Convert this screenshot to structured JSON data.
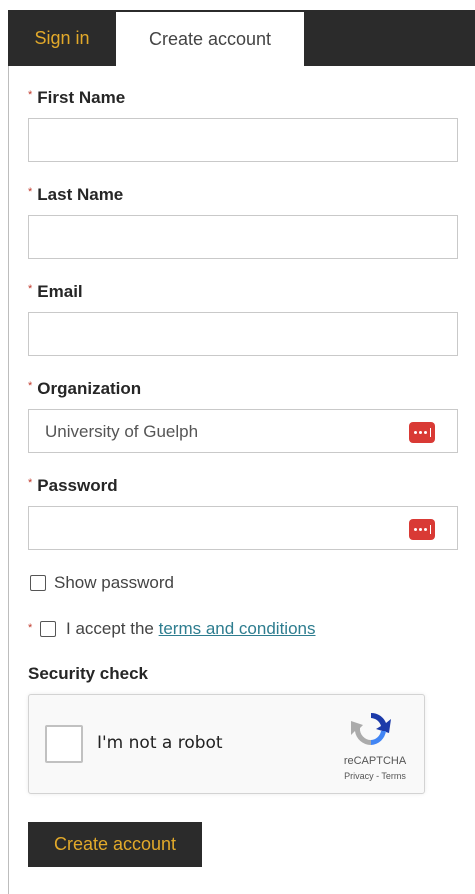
{
  "tabs": {
    "signin": "Sign in",
    "create": "Create account"
  },
  "form": {
    "first_name_label": "First Name",
    "last_name_label": "Last Name",
    "email_label": "Email",
    "organization_label": "Organization",
    "organization_value": "University of Guelph",
    "password_label": "Password",
    "required_marker": "*"
  },
  "options": {
    "show_password": "Show password",
    "accept_prefix": "I accept the",
    "terms_link": "terms and conditions"
  },
  "security": {
    "title": "Security check",
    "robot_text": "I'm not a robot",
    "brand": "reCAPTCHA",
    "links": "Privacy - Terms"
  },
  "submit_label": "Create account",
  "colors": {
    "accent": "#e2a92a",
    "dark": "#2b2b2b",
    "link": "#2e7d8f",
    "required": "#c0392b",
    "password_icon": "#d93a35"
  }
}
